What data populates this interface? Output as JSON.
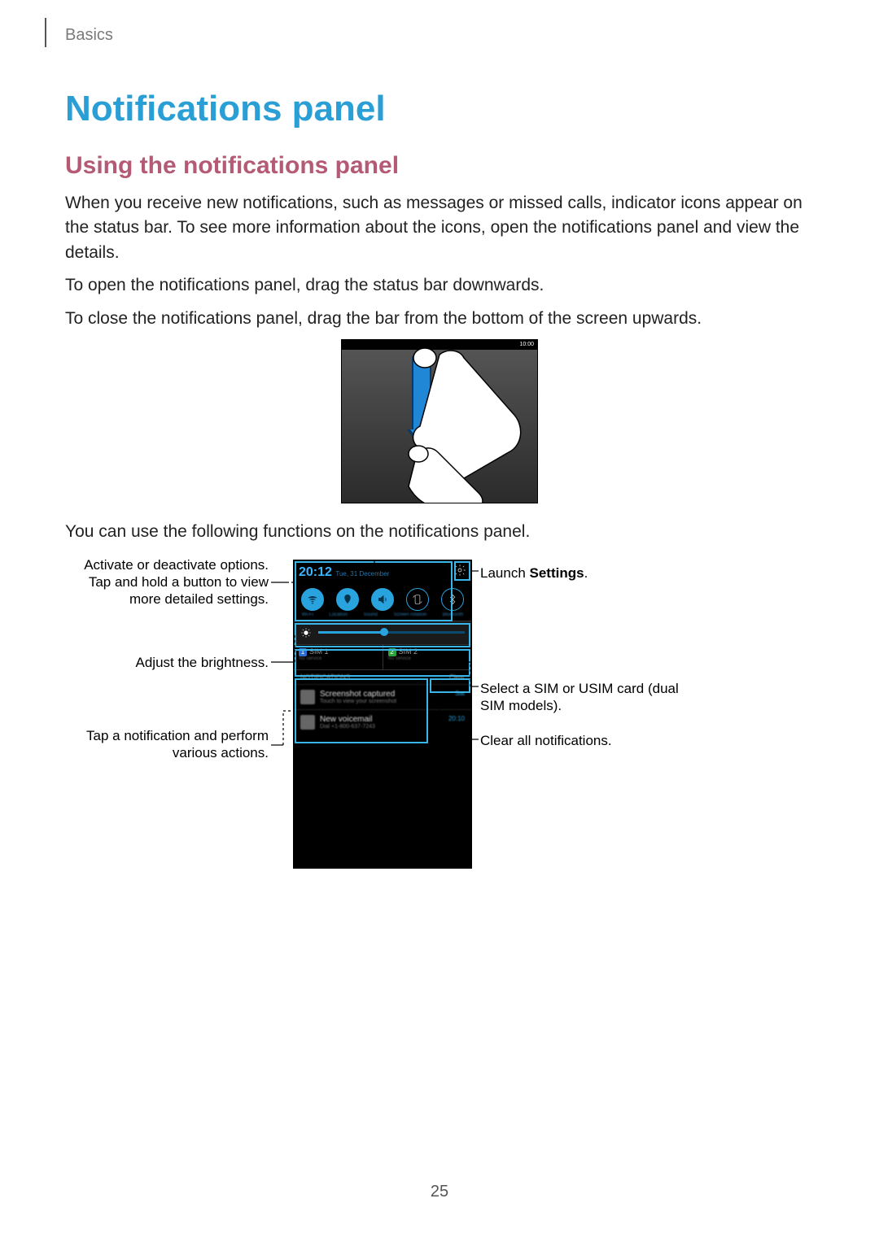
{
  "breadcrumb": "Basics",
  "title": "Notifications panel",
  "subtitle": "Using the notifications panel",
  "para1": "When you receive new notifications, such as messages or missed calls, indicator icons appear on the status bar. To see more information about the icons, open the notifications panel and view the details.",
  "para2": "To open the notifications panel, drag the status bar downwards.",
  "para3": "To close the notifications panel, drag the bar from the bottom of the screen upwards.",
  "para4": "You can use the following functions on the notifications panel.",
  "illus1_status_time": "10:00",
  "phone": {
    "time": "20:12",
    "date": "Tue, 31 December",
    "toggles": [
      "Wi-Fi",
      "Location",
      "Sound",
      "Screen rotation",
      "Bluetooth"
    ],
    "sim1": {
      "badge": "1",
      "label": "SIM 1",
      "sub": "No service"
    },
    "sim2": {
      "badge": "2",
      "label": "SIM 2",
      "sub": "No service"
    },
    "notif_header_left": "NOTIFICATIONS",
    "notif_header_right": "Clear",
    "notif1": {
      "title": "Screenshot captured",
      "sub": "Touch to view your screenshot",
      "time": "Sat"
    },
    "notif2": {
      "title": "New voicemail",
      "sub": "Dial +1-800-637-7243",
      "time": "20:10"
    }
  },
  "labels": {
    "left1": "Activate or deactivate options. Tap and hold a button to view more detailed settings.",
    "left2": "Adjust the brightness.",
    "left3": "Tap a notification and perform various actions.",
    "right1_pre": "Launch ",
    "right1_strong": "Settings",
    "right1_post": ".",
    "right2": "Select a SIM or USIM card (dual SIM models).",
    "right3": "Clear all notifications."
  },
  "pagenum": "25"
}
